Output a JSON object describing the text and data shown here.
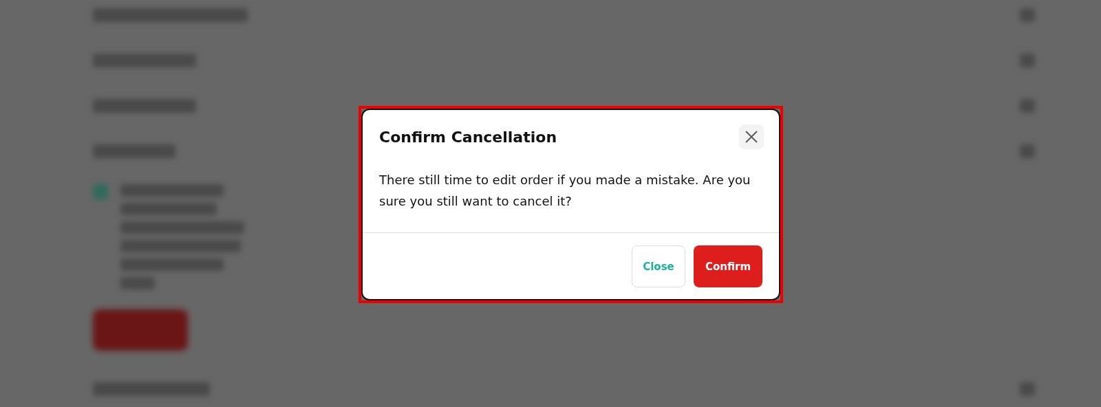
{
  "dialog": {
    "title": "Confirm Cancellation",
    "message": "There still time to edit order if you made a mistake. Are you sure you still want to cancel it?",
    "highlighted": true,
    "buttons": [
      {
        "label": "Close",
        "kind": "secondary"
      },
      {
        "label": "Confirm",
        "kind": "primary"
      }
    ]
  }
}
